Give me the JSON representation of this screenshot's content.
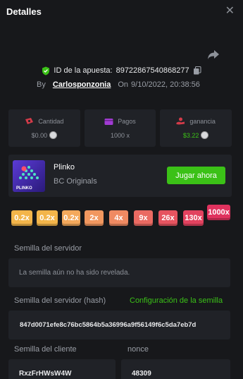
{
  "header": {
    "title": "Detalles"
  },
  "bet": {
    "id_label": "ID de la apuesta:",
    "id_value": "89722867540868277",
    "by_label": "By",
    "user": "Carlosponzonia",
    "on_label": "On",
    "date": "9/10/2022, 20:38:56"
  },
  "stats": [
    {
      "label": "Cantidad",
      "value": "$0.00",
      "icon": "money-icon",
      "color": "#d33b49"
    },
    {
      "label": "Pagos",
      "value": "1000 x",
      "icon": "wallet-icon",
      "color": "#a13bd3"
    },
    {
      "label": "ganancia",
      "value": "$3.22",
      "icon": "hand-coin-icon",
      "color": "#d33b49",
      "value_color": "#3bc117"
    }
  ],
  "game": {
    "name": "Plinko",
    "provider": "BC Originals",
    "play_label": "Jugar ahora",
    "thumb_text": "PLINKO"
  },
  "multipliers": [
    {
      "label": "0.2x",
      "color": "#f3b54a"
    },
    {
      "label": "0.2x",
      "color": "#f3b54a"
    },
    {
      "label": "0.2x",
      "color": "#f4a95c"
    },
    {
      "label": "2x",
      "color": "#f1975f"
    },
    {
      "label": "4x",
      "color": "#ef8a62"
    },
    {
      "label": "9x",
      "color": "#ea6a62"
    },
    {
      "label": "26x",
      "color": "#e65460"
    },
    {
      "label": "130x",
      "color": "#e2425f"
    },
    {
      "label": "1000x",
      "color": "#e0325e",
      "active": true
    }
  ],
  "fields": {
    "server_seed_label": "Semilla del servidor",
    "server_seed_value": "La semilla aún no ha sido revelada.",
    "server_hash_label": "Semilla del servidor (hash)",
    "seed_config_link": "Configuración de la semilla",
    "server_hash_value": "847d0071efe8c76bc5864b5a36996a9f56149f6c5da7eb7d",
    "client_seed_label": "Semilla del cliente",
    "nonce_label": "nonce",
    "client_seed_value": "RxzFrHWsW4W",
    "nonce_value": "48309"
  }
}
